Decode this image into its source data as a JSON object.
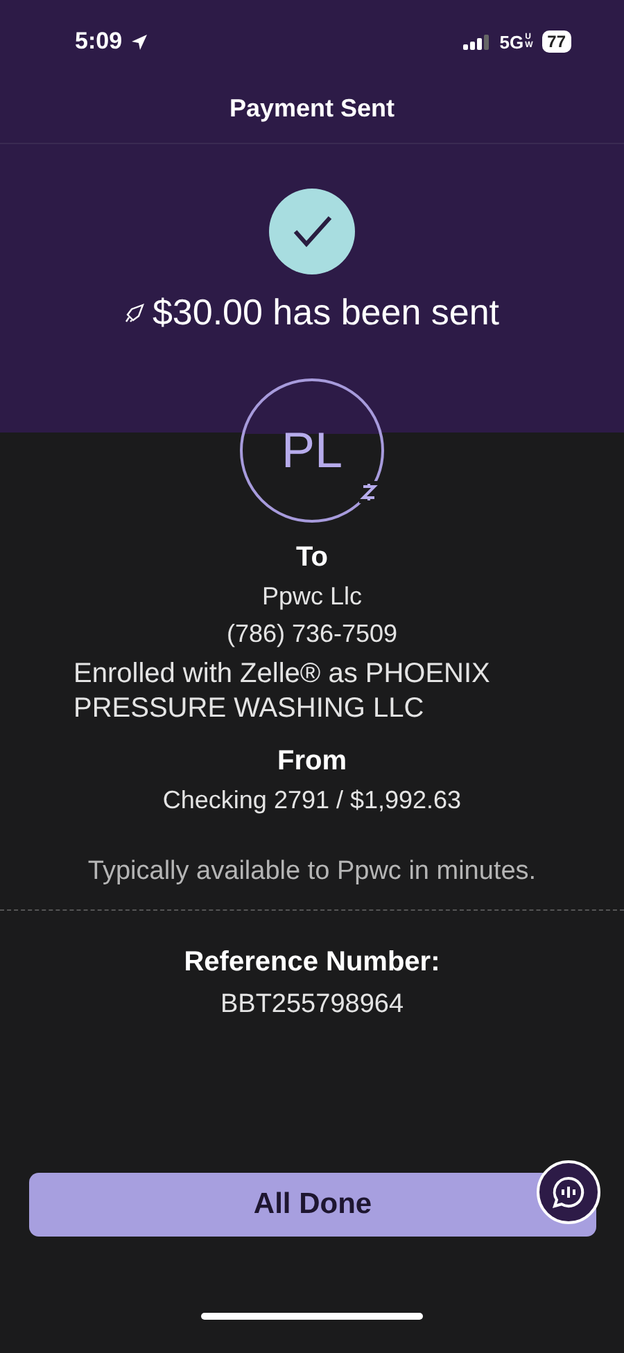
{
  "status_bar": {
    "time": "5:09",
    "network": "5G",
    "network_badge": "UW",
    "battery": "77"
  },
  "header": {
    "title": "Payment Sent"
  },
  "confirmation": {
    "message": "$30.00 has been sent"
  },
  "recipient": {
    "initials": "PL",
    "heading": "To",
    "name": "Ppwc Llc",
    "phone": "(786) 736-7509",
    "enrollment": "Enrolled with Zelle® as PHOENIX PRESSURE WASHING LLC"
  },
  "sender": {
    "heading": "From",
    "account": "Checking 2791 / $1,992.63"
  },
  "availability": "Typically available to Ppwc in minutes.",
  "reference": {
    "heading": "Reference Number:",
    "number": "BBT255798964"
  },
  "primary_button": "All Done"
}
